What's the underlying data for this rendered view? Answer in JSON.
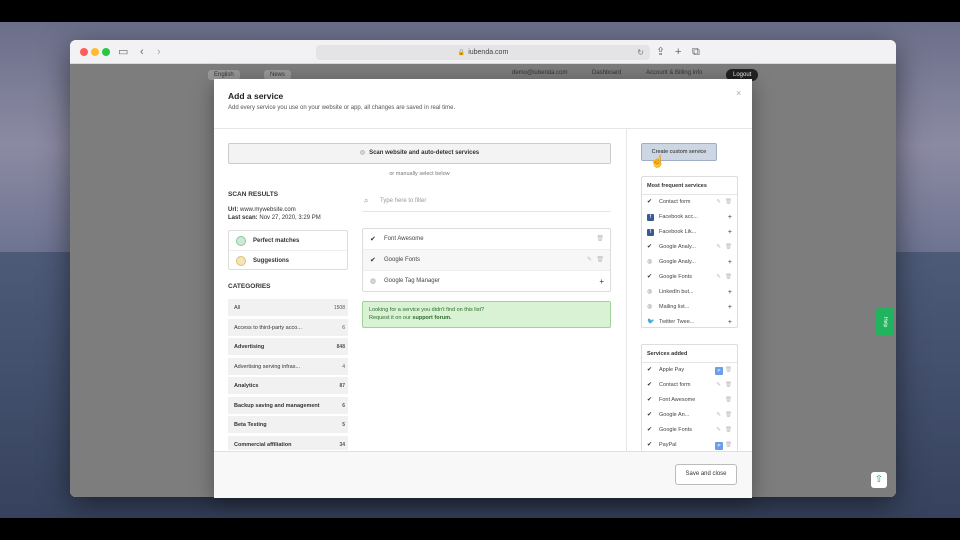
{
  "browser": {
    "url": "iubenda.com"
  },
  "page": {
    "nav": [
      "English",
      "News",
      "demo@iubenda.com",
      "Dashboard",
      "Account & Billing info"
    ],
    "logout": "Logout",
    "help": "Help"
  },
  "modal": {
    "title": "Add a service",
    "subtitle": "Add every service you use on your website or app, all changes are saved in real time.",
    "scan_button": "Scan website and auto-detect services",
    "or_text": "or manually select below",
    "scan_results": {
      "title": "SCAN RESULTS",
      "url_label": "Url:",
      "url_value": "www.mywebsite.com",
      "last_scan_label": "Last scan:",
      "last_scan_value": "Nov 27, 2020, 3:29 PM",
      "perfect_matches": "Perfect matches",
      "suggestions": "Suggestions"
    },
    "categories": {
      "title": "CATEGORIES",
      "items": [
        {
          "label": "All",
          "count": "1508",
          "bold": false
        },
        {
          "label": "Access to third-party acco...",
          "count": "6",
          "bold": false
        },
        {
          "label": "Advertising",
          "count": "848",
          "bold": true
        },
        {
          "label": "Advertising serving infras...",
          "count": "4",
          "bold": false
        },
        {
          "label": "Analytics",
          "count": "87",
          "bold": true
        },
        {
          "label": "Backup saving and management",
          "count": "6",
          "bold": false
        },
        {
          "label": "Beta Testing",
          "count": "5",
          "bold": true
        },
        {
          "label": "Commercial affiliation",
          "count": "34",
          "bold": false
        }
      ]
    },
    "filter_placeholder": "Type here to filter",
    "services": [
      {
        "label": "Font Awesome",
        "icon": "check-icon",
        "state": "added"
      },
      {
        "label": "Google Fonts",
        "icon": "check-icon",
        "state": "added-editable"
      },
      {
        "label": "Google Tag Manager",
        "icon": "globe-icon",
        "state": "available"
      }
    ],
    "notice": {
      "line1": "Looking for a service you didn't find on this list?",
      "line2_prefix": "Request it on our ",
      "line2_link": "support forum."
    },
    "create_custom": "Create custom service",
    "most_frequent": {
      "title": "Most frequent services",
      "items": [
        {
          "label": "Contact form",
          "icon": "check-icon",
          "action": "edit-trash"
        },
        {
          "label": "Facebook acc...",
          "icon": "facebook-icon",
          "action": "add"
        },
        {
          "label": "Facebook Lik...",
          "icon": "facebook-icon",
          "action": "add"
        },
        {
          "label": "Google Analy...",
          "icon": "check-icon",
          "action": "edit-trash"
        },
        {
          "label": "Google Analy...",
          "icon": "globe-icon",
          "action": "add"
        },
        {
          "label": "Google Fonts",
          "icon": "check-icon",
          "action": "edit-trash"
        },
        {
          "label": "LinkedIn but...",
          "icon": "globe-icon",
          "action": "add"
        },
        {
          "label": "Mailing list...",
          "icon": "globe-icon",
          "action": "add"
        },
        {
          "label": "Twitter Twee...",
          "icon": "twitter-icon",
          "action": "add"
        }
      ]
    },
    "services_added": {
      "title": "Services added",
      "items": [
        {
          "label": "Apple Pay",
          "action": "tag-trash"
        },
        {
          "label": "Contact form",
          "action": "edit-trash"
        },
        {
          "label": "Font Awesome",
          "action": "trash"
        },
        {
          "label": "Google An...",
          "action": "edit-trash"
        },
        {
          "label": "Google Fonts",
          "action": "edit-trash"
        },
        {
          "label": "PayPal",
          "action": "tag-trash"
        }
      ]
    },
    "save_button": "Save and close"
  }
}
